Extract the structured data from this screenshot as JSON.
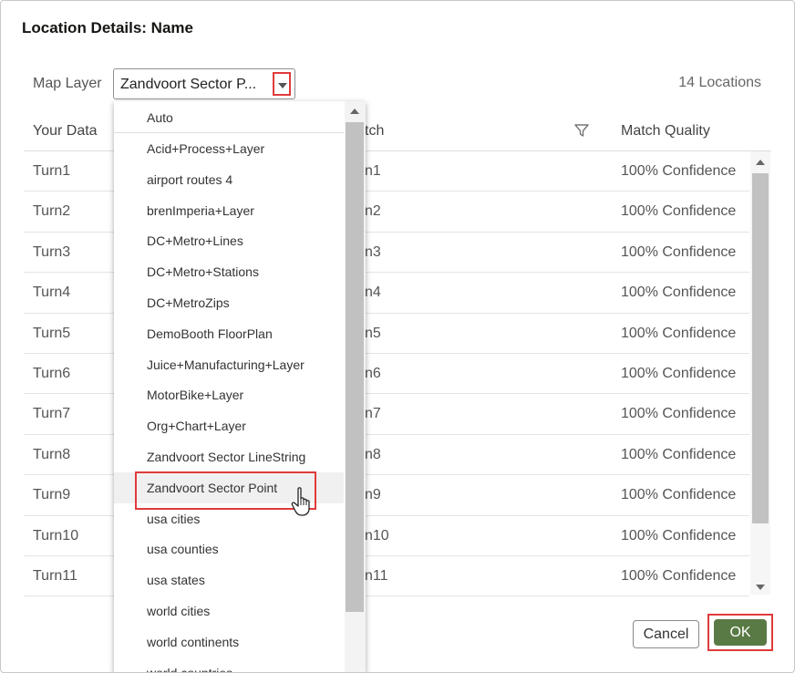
{
  "dialog": {
    "title": "Location Details: Name"
  },
  "toolbar": {
    "map_layer_label": "Map Layer",
    "map_layer_value": "Zandvoort Sector P...",
    "locations_count": "14 Locations"
  },
  "grid": {
    "headers": {
      "your_data": "Your Data",
      "match": "tch",
      "match_quality": "Match Quality"
    },
    "rows": [
      {
        "your_data": "Turn1",
        "match": "n1",
        "quality": "100% Confidence"
      },
      {
        "your_data": "Turn2",
        "match": "n2",
        "quality": "100% Confidence"
      },
      {
        "your_data": "Turn3",
        "match": "n3",
        "quality": "100% Confidence"
      },
      {
        "your_data": "Turn4",
        "match": "n4",
        "quality": "100% Confidence"
      },
      {
        "your_data": "Turn5",
        "match": "n5",
        "quality": "100% Confidence"
      },
      {
        "your_data": "Turn6",
        "match": "n6",
        "quality": "100% Confidence"
      },
      {
        "your_data": "Turn7",
        "match": "n7",
        "quality": "100% Confidence"
      },
      {
        "your_data": "Turn8",
        "match": "n8",
        "quality": "100% Confidence"
      },
      {
        "your_data": "Turn9",
        "match": "n9",
        "quality": "100% Confidence"
      },
      {
        "your_data": "Turn10",
        "match": "n10",
        "quality": "100% Confidence"
      },
      {
        "your_data": "Turn11",
        "match": "n11",
        "quality": "100% Confidence"
      }
    ]
  },
  "dropdown": {
    "items": [
      "Auto",
      "Acid+Process+Layer",
      "airport routes 4",
      "brenImperia+Layer",
      "DC+Metro+Lines",
      "DC+Metro+Stations",
      "DC+MetroZips",
      "DemoBooth FloorPlan",
      "Juice+Manufacturing+Layer",
      "MotorBike+Layer",
      "Org+Chart+Layer",
      "Zandvoort Sector LineString",
      "Zandvoort Sector Point",
      "usa cities",
      "usa counties",
      "usa states",
      "world cities",
      "world continents",
      "world countries"
    ],
    "selected": "Zandvoort Sector Point"
  },
  "buttons": {
    "cancel": "Cancel",
    "ok": "OK"
  },
  "colors": {
    "ok_button": "#5a7a45",
    "highlight_box": "#e03b3b"
  },
  "icons": {
    "filter": "filter-icon",
    "cursor": "hand-pointer-icon",
    "dropdown": "chevron-down-icon"
  }
}
